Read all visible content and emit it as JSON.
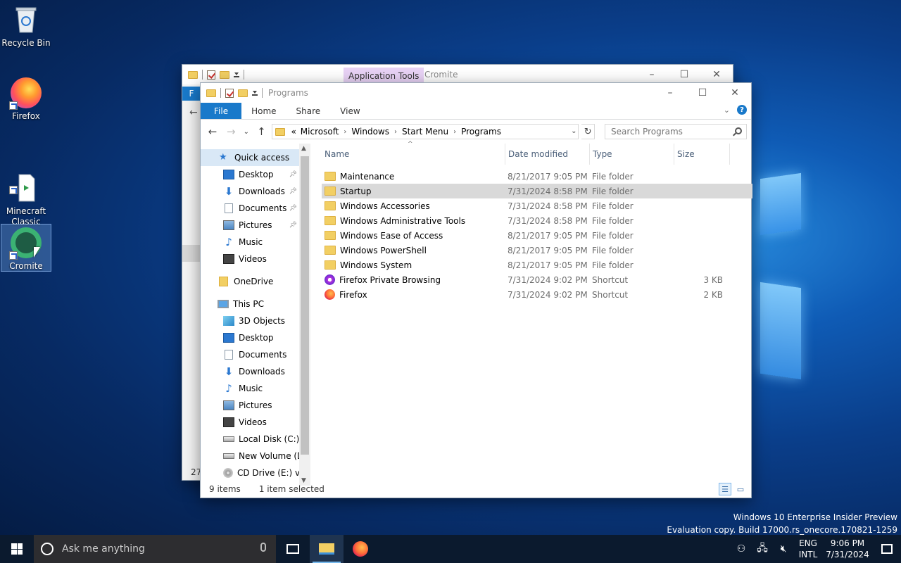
{
  "desktop": {
    "icons": [
      {
        "label": "Recycle Bin"
      },
      {
        "label": "Firefox"
      },
      {
        "label": "Minecraft\nClassic"
      },
      {
        "label": "Cromite"
      }
    ]
  },
  "back_window": {
    "contextual_tab": "Application Tools",
    "title": "Cromite",
    "file_tab_partial": "F",
    "status_partial": "27"
  },
  "window": {
    "title": "Programs",
    "ribbon_tabs": {
      "file": "File",
      "home": "Home",
      "share": "Share",
      "view": "View"
    },
    "address": {
      "overflow": "«",
      "crumbs": [
        "Microsoft",
        "Windows",
        "Start Menu",
        "Programs"
      ]
    },
    "search_placeholder": "Search Programs",
    "nav": {
      "quick_access": "Quick access",
      "quick_items": [
        "Desktop",
        "Downloads",
        "Documents",
        "Pictures",
        "Music",
        "Videos"
      ],
      "onedrive": "OneDrive",
      "this_pc": "This PC",
      "pc_items": [
        "3D Objects",
        "Desktop",
        "Documents",
        "Downloads",
        "Music",
        "Pictures",
        "Videos",
        "Local Disk (C:)",
        "New Volume (D:",
        "CD Drive (E:) virt"
      ]
    },
    "columns": {
      "name": "Name",
      "date": "Date modified",
      "type": "Type",
      "size": "Size"
    },
    "files": [
      {
        "name": "Maintenance",
        "date": "8/21/2017 9:05 PM",
        "type": "File folder",
        "size": "",
        "icon": "folder"
      },
      {
        "name": "Startup",
        "date": "7/31/2024 8:58 PM",
        "type": "File folder",
        "size": "",
        "icon": "folder"
      },
      {
        "name": "Windows Accessories",
        "date": "7/31/2024 8:58 PM",
        "type": "File folder",
        "size": "",
        "icon": "folder"
      },
      {
        "name": "Windows Administrative Tools",
        "date": "7/31/2024 8:58 PM",
        "type": "File folder",
        "size": "",
        "icon": "folder"
      },
      {
        "name": "Windows Ease of Access",
        "date": "8/21/2017 9:05 PM",
        "type": "File folder",
        "size": "",
        "icon": "folder"
      },
      {
        "name": "Windows PowerShell",
        "date": "8/21/2017 9:05 PM",
        "type": "File folder",
        "size": "",
        "icon": "folder"
      },
      {
        "name": "Windows System",
        "date": "8/21/2017 9:05 PM",
        "type": "File folder",
        "size": "",
        "icon": "folder"
      },
      {
        "name": "Firefox Private Browsing",
        "date": "7/31/2024 9:02 PM",
        "type": "Shortcut",
        "size": "3 KB",
        "icon": "firefox-private"
      },
      {
        "name": "Firefox",
        "date": "7/31/2024 9:02 PM",
        "type": "Shortcut",
        "size": "2 KB",
        "icon": "firefox"
      }
    ],
    "status": {
      "count": "9 items",
      "selected": "1 item selected"
    }
  },
  "watermark": {
    "line1": "Windows 10 Enterprise Insider Preview",
    "line2": "Evaluation copy. Build 17000.rs_onecore.170821-1259"
  },
  "taskbar": {
    "search_placeholder": "Ask me anything",
    "lang_top": "ENG",
    "lang_bottom": "INTL",
    "time": "9:06 PM",
    "date": "7/31/2024"
  },
  "colors": {
    "file_tab": "#1979ca",
    "selection": "#d9e8f6",
    "contextual_tab": "#e8d2f5"
  }
}
